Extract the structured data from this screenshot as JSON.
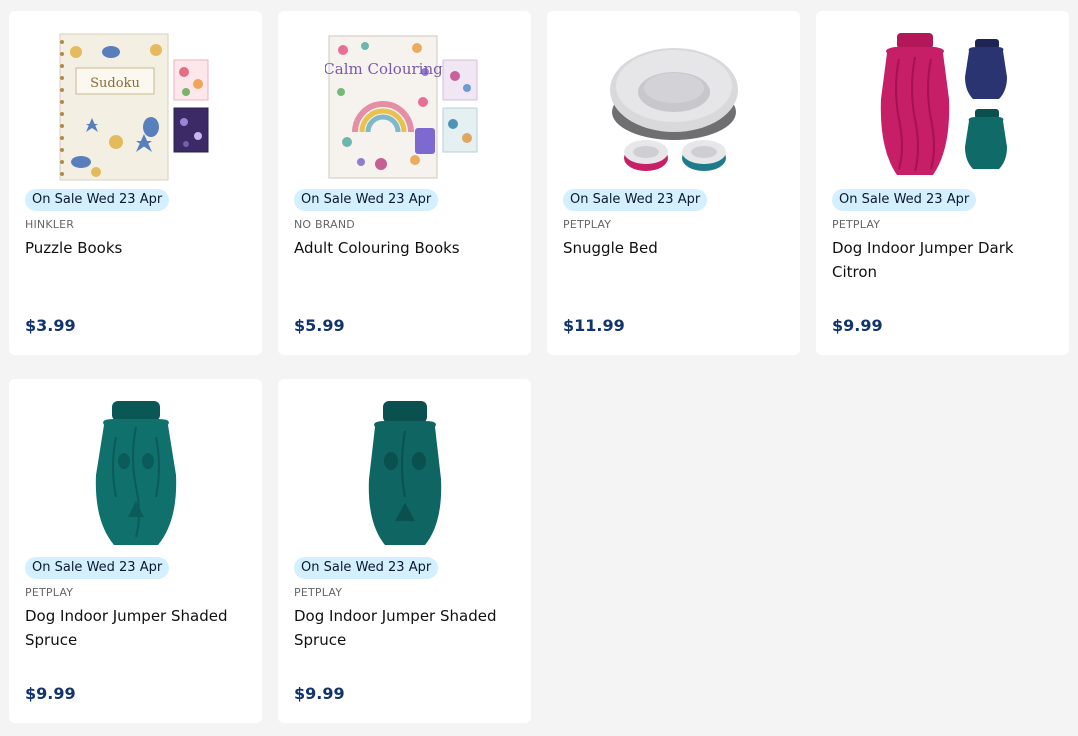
{
  "products": [
    {
      "badge": "On Sale Wed 23 Apr",
      "brand": "HINKLER",
      "name": "Puzzle Books",
      "price": "$3.99",
      "image": "sudoku-book-image",
      "cover_title": "Sudoku"
    },
    {
      "badge": "On Sale Wed 23 Apr",
      "brand": "NO BRAND",
      "name": "Adult Colouring Books",
      "price": "$5.99",
      "image": "colouring-book-image",
      "cover_title": "Calm Colouring"
    },
    {
      "badge": "On Sale Wed 23 Apr",
      "brand": "PETPLAY",
      "name": "Snuggle Bed",
      "price": "$11.99",
      "image": "pet-bed-image"
    },
    {
      "badge": "On Sale Wed 23 Apr",
      "brand": "PETPLAY",
      "name": "Dog Indoor Jumper Dark Citron",
      "price": "$9.99",
      "image": "dog-jumper-pink-image"
    },
    {
      "badge": "On Sale Wed 23 Apr",
      "brand": "PETPLAY",
      "name": "Dog Indoor Jumper Shaded Spruce",
      "price": "$9.99",
      "image": "dog-jumper-teal-image"
    },
    {
      "badge": "On Sale Wed 23 Apr",
      "brand": "PETPLAY",
      "name": "Dog Indoor Jumper Shaded Spruce",
      "price": "$9.99",
      "image": "dog-jumper-teal-image"
    }
  ],
  "colors": {
    "badge_bg": "#d4efff",
    "price": "#11336e",
    "page_bg": "#f4f4f4"
  }
}
